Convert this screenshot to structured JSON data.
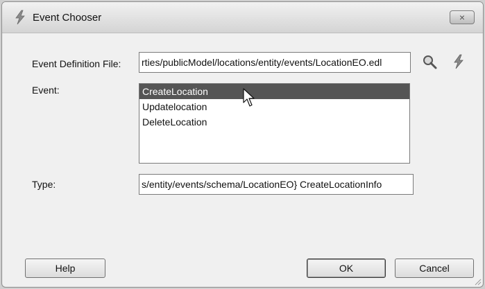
{
  "window": {
    "title": "Event Chooser",
    "close_label": "×"
  },
  "form": {
    "event_definition_label": "Event Definition File:",
    "event_definition_value": "rties/publicModel/locations/entity/events/LocationEO.edl",
    "event_label": "Event:",
    "events": [
      "CreateLocation",
      "Updatelocation",
      "DeleteLocation"
    ],
    "selected_event": "CreateLocation",
    "type_label": "Type:",
    "type_value": "s/entity/events/schema/LocationEO} CreateLocationInfo"
  },
  "icons": {
    "title": "lightning-icon",
    "browse": "search-icon",
    "create": "lightning-icon"
  },
  "buttons": {
    "help": "Help",
    "ok": "OK",
    "cancel": "Cancel"
  },
  "colors": {
    "selection": "#555555",
    "field_border": "#7a7a7a"
  }
}
